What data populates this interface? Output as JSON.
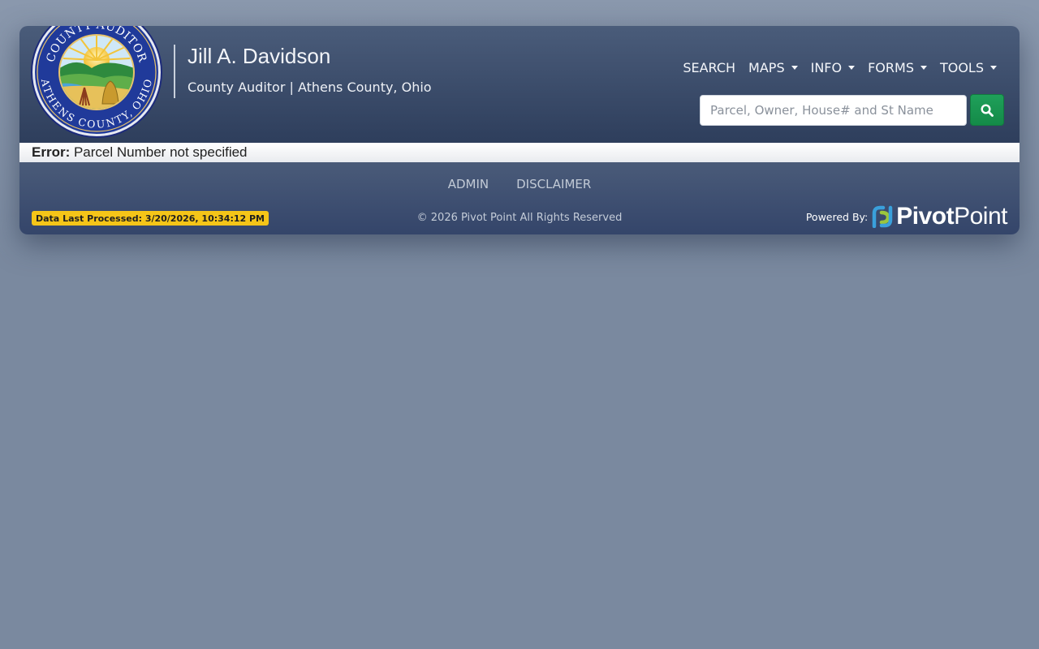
{
  "header": {
    "seal_top_text": "COUNTY AUDITOR",
    "seal_bottom_text": "ATHENS COUNTY, OHIO",
    "title": "Jill A. Davidson",
    "subtitle": "County Auditor | Athens County, Ohio"
  },
  "nav": {
    "items": [
      {
        "label": "SEARCH",
        "dropdown": false
      },
      {
        "label": "MAPS",
        "dropdown": true
      },
      {
        "label": "INFO",
        "dropdown": true
      },
      {
        "label": "FORMS",
        "dropdown": true
      },
      {
        "label": "TOOLS",
        "dropdown": true
      }
    ]
  },
  "search": {
    "placeholder": "Parcel, Owner, House# and St Name",
    "value": "",
    "button_icon": "search-icon"
  },
  "error": {
    "label": "Error:",
    "message": "Parcel Number not specified"
  },
  "footer": {
    "links": [
      "ADMIN",
      "DISCLAIMER"
    ],
    "data_processed": "Data Last Processed: 3/20/2026, 10:34:12 PM",
    "copyright": "© 2026 Pivot Point All Rights Reserved",
    "powered_by": "Powered By:",
    "logo_part1": "Pivot",
    "logo_part2": "Point"
  },
  "colors": {
    "header_top": "#4a5c7a",
    "header_bottom": "#2e3e5c",
    "search_button": "#1a9550",
    "badge": "#f5c518",
    "logo_blue": "#3aa0db",
    "logo_green": "#9bc53d"
  }
}
